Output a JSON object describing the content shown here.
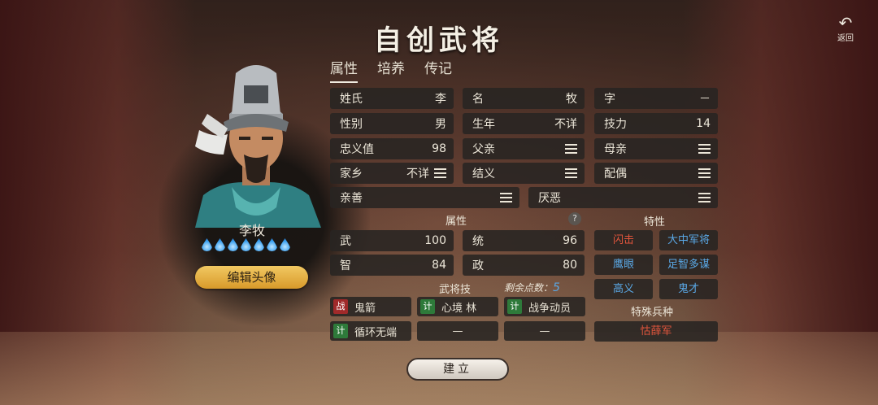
{
  "title": "自创武将",
  "back": {
    "label": "返回"
  },
  "tabs": [
    "属性",
    "培养",
    "传记"
  ],
  "general": {
    "name": "李牧",
    "drops": 7,
    "edit_label": "编辑头像"
  },
  "info": {
    "surname": {
      "label": "姓氏",
      "value": "李"
    },
    "given": {
      "label": "名",
      "value": "牧"
    },
    "courtesy": {
      "label": "字",
      "value": "－"
    },
    "gender": {
      "label": "性别",
      "value": "男"
    },
    "birth": {
      "label": "生年",
      "value": "不详"
    },
    "skill_power": {
      "label": "技力",
      "value": "14"
    },
    "loyalty": {
      "label": "忠义值",
      "value": "98"
    },
    "father": {
      "label": "父亲"
    },
    "mother": {
      "label": "母亲"
    },
    "hometown": {
      "label": "家乡",
      "value": "不详"
    },
    "sworn": {
      "label": "结义"
    },
    "spouse": {
      "label": "配偶"
    },
    "likes": {
      "label": "亲善"
    },
    "dislikes": {
      "label": "厌恶"
    }
  },
  "stats_title": "属性",
  "stats": {
    "war": {
      "label": "武",
      "value": "100"
    },
    "lead": {
      "label": "统",
      "value": "96"
    },
    "intel": {
      "label": "智",
      "value": "84"
    },
    "pol": {
      "label": "政",
      "value": "80"
    }
  },
  "traits_title": "特性",
  "traits": [
    {
      "label": "闪击",
      "color": "#e0553c"
    },
    {
      "label": "大中军将",
      "color": "#5aa8e6"
    },
    {
      "label": "鹰眼",
      "color": "#5aa8e6"
    },
    {
      "label": "足智多谋",
      "color": "#5aa8e6"
    },
    {
      "label": "高义",
      "color": "#5aa8e6"
    },
    {
      "label": "鬼才",
      "color": "#5aa8e6"
    }
  ],
  "skills_title": "武将技",
  "points": {
    "label": "剩余点数：",
    "value": "5"
  },
  "skills": [
    {
      "tag": "战",
      "tag_color": "#a02a2a",
      "label": "鬼箭"
    },
    {
      "tag": "计",
      "tag_color": "#2e7a3a",
      "label": "心境 林"
    },
    {
      "tag": "计",
      "tag_color": "#2e7a3a",
      "label": "战争动员"
    },
    {
      "tag": "计",
      "tag_color": "#2e7a3a",
      "label": "循环无端"
    },
    {
      "label": "—"
    },
    {
      "label": "—"
    }
  ],
  "troop_title": "特殊兵种",
  "troop": {
    "label": "怙薛军",
    "color": "#e0553c"
  },
  "create_label": "建立"
}
